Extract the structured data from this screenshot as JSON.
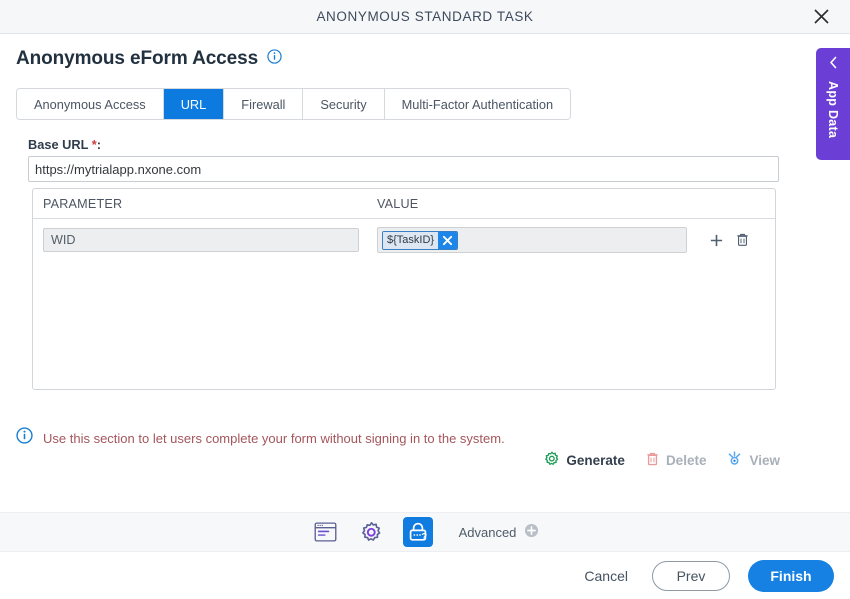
{
  "window": {
    "title": "ANONYMOUS STANDARD TASK",
    "close_icon": "close-icon"
  },
  "page": {
    "heading": "Anonymous eForm Access",
    "heading_info_icon": "info-icon"
  },
  "tabs": [
    {
      "label": "Anonymous Access",
      "active": false
    },
    {
      "label": "URL",
      "active": true
    },
    {
      "label": "Firewall",
      "active": false
    },
    {
      "label": "Security",
      "active": false
    },
    {
      "label": "Multi-Factor Authentication",
      "active": false
    }
  ],
  "base_url": {
    "label": "Base URL",
    "required_mark": "*",
    "colon": ":",
    "value": "https://mytrialapp.nxone.com",
    "placeholder": "https://"
  },
  "parameters_table": {
    "columns": [
      "PARAMETER",
      "VALUE"
    ],
    "rows": [
      {
        "parameter": "WID",
        "value_token": "${TaskID}",
        "token_remove_icon": "close-icon",
        "add_icon": "plus-icon",
        "delete_icon": "trash-icon"
      }
    ]
  },
  "note": {
    "icon": "info-icon",
    "text": "Use this section to let users complete your form without signing in to the system."
  },
  "actions": [
    {
      "label": "Generate",
      "icon": "gear-icon",
      "enabled": true
    },
    {
      "label": "Delete",
      "icon": "trash-icon",
      "enabled": false
    },
    {
      "label": "View",
      "icon": "view-icon",
      "enabled": false
    }
  ],
  "toolbar": {
    "buttons": [
      {
        "icon": "form-icon",
        "active": false
      },
      {
        "icon": "gear-icon",
        "active": false
      },
      {
        "icon": "lock-question-icon",
        "active": true
      }
    ],
    "advanced_label": "Advanced",
    "advanced_icon": "plus-circle-icon"
  },
  "footer": {
    "cancel_label": "Cancel",
    "prev_label": "Prev",
    "finish_label": "Finish"
  },
  "side_panel": {
    "label": "App Data",
    "collapse_icon": "chevron-left-icon"
  },
  "colors": {
    "accent_blue": "#0c7ade",
    "primary_blue": "#1681e2",
    "purple": "#6b3ed6",
    "note_red": "#a4565c",
    "required_red": "#cf3a3a",
    "green": "#1f9d55",
    "toolbar_bg": "#f7f8fa",
    "titlebar_bg": "#f6f7f9"
  }
}
